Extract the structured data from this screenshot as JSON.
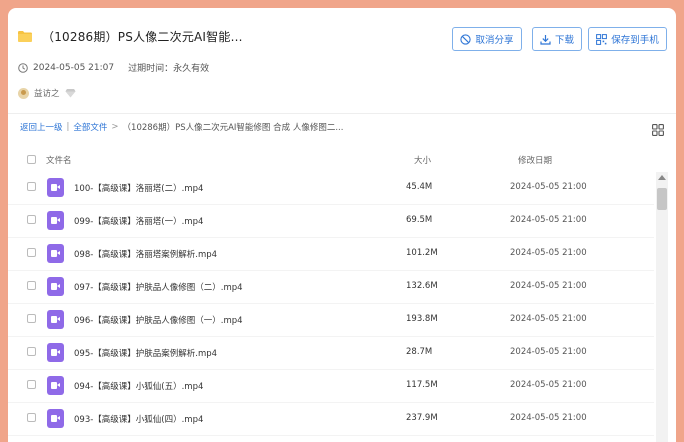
{
  "header": {
    "title": "（10286期）PS人像二次元AI智能...",
    "buttons": {
      "cancel_share": "取消分享",
      "download": "下载",
      "save_to_phone": "保存到手机"
    },
    "datetime": "2024-05-05 21:07",
    "expiry_label": "过期时间：永久有效",
    "user_name": "益访之"
  },
  "breadcrumb": {
    "back": "返回上一级",
    "separator": "|",
    "all_files": "全部文件",
    "arrow": ">",
    "current": "（10286期）PS人像二次元AI智能修图 合成 人像修图二..."
  },
  "table": {
    "headers": {
      "name": "文件名",
      "size": "大小",
      "date": "修改日期"
    },
    "rows": [
      {
        "name": "100-【高级课】洛丽塔(二）.mp4",
        "size": "45.4M",
        "date": "2024-05-05 21:00"
      },
      {
        "name": "099-【高级课】洛丽塔(一）.mp4",
        "size": "69.5M",
        "date": "2024-05-05 21:00"
      },
      {
        "name": "098-【高级课】洛丽塔案例解析.mp4",
        "size": "101.2M",
        "date": "2024-05-05 21:00"
      },
      {
        "name": "097-【高级课】护肤品人像修图（二）.mp4",
        "size": "132.6M",
        "date": "2024-05-05 21:00"
      },
      {
        "name": "096-【高级课】护肤品人像修图（一）.mp4",
        "size": "193.8M",
        "date": "2024-05-05 21:00"
      },
      {
        "name": "095-【高级课】护肤品案例解析.mp4",
        "size": "28.7M",
        "date": "2024-05-05 21:00"
      },
      {
        "name": "094-【高级课】小狐仙(五）.mp4",
        "size": "117.5M",
        "date": "2024-05-05 21:00"
      },
      {
        "name": "093-【高级课】小狐仙(四）.mp4",
        "size": "237.9M",
        "date": "2024-05-05 21:00"
      }
    ]
  },
  "colors": {
    "background": "#f0a58a",
    "accent": "#2f76d6",
    "video_icon": "#8f6ae8"
  }
}
